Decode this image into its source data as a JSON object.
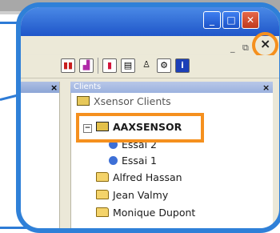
{
  "window": {
    "minimize_glyph": "_",
    "maximize_glyph": "□",
    "close_glyph": "✕"
  },
  "mdi": {
    "minimize_glyph": "_",
    "restore_glyph": "⧉",
    "close_glyph": "×"
  },
  "left_pane": {
    "close_glyph": "×"
  },
  "clients_pane": {
    "title": "Clients",
    "close_glyph": "×",
    "tree": {
      "root": "Xsensor Clients",
      "selected_client": "AAXSENSOR",
      "sessions": [
        "Essai 2",
        "Essai 1"
      ],
      "clients": [
        "Alfred Hassan",
        "Jean Valmy",
        "Monique Dupont"
      ]
    }
  },
  "highlight_color": "#f5901e",
  "frame_color": "#2f80d8"
}
